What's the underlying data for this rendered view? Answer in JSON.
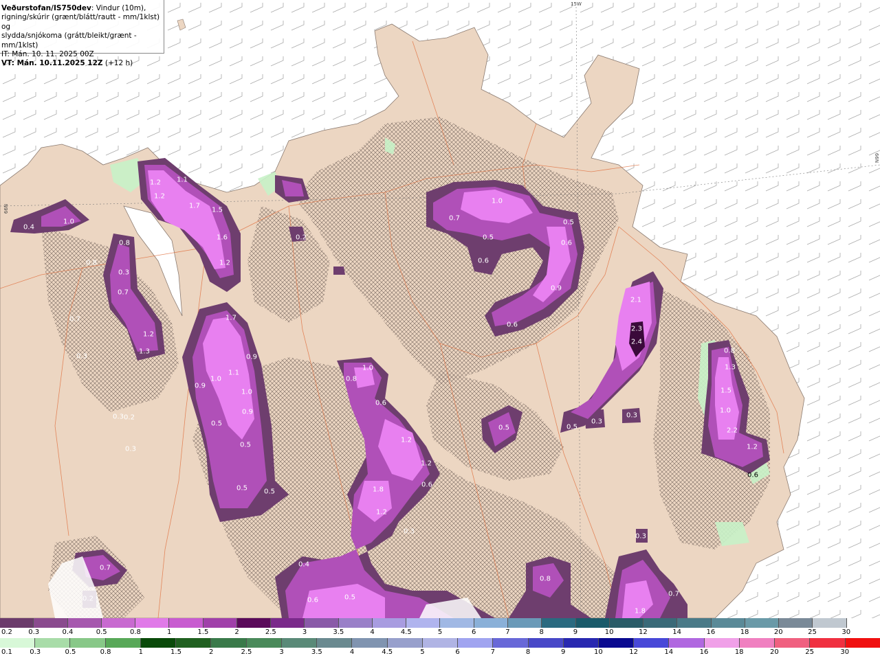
{
  "title": {
    "line1_bold": "Veðurstofan/IS750dev",
    "line1_rest": ": Vindur (10m),",
    "line2": "rigning/skúrir (grænt/blátt/rautt - mm/1klst) og",
    "line3": "slydda/snjókoma (grátt/bleikt/grænt - mm/1klst)",
    "line4": "IT: Mán. 10. 11. 2025 00Z",
    "line5_bold": "VT: Mán. 10.11.2025 12Z",
    "line5_rest": " (+12 h)"
  },
  "grid_labels": {
    "lon": "15W",
    "lat": "66N"
  },
  "colors": {
    "sea": "#ffffff",
    "land": "#ecd6c2",
    "roads": "#e07040",
    "snow_dark": "#6e3e6e",
    "snow_mid": "#b050b8",
    "snow_light": "#e880f0",
    "snow_core": "#3a0a3a",
    "rain_light": "#c8f2c8"
  },
  "precip_labels": [
    "1.2",
    "1.1",
    "1.2",
    "1.7",
    "1.5",
    "1.6",
    "1.2",
    "0.8",
    "0.4",
    "1.0",
    "0.8",
    "0.3",
    "0.7",
    "0.7",
    "1.2",
    "1.3",
    "0.3",
    "0.3",
    "0.2",
    "0.3",
    "1.7",
    "0.9",
    "1.0",
    "1.1",
    "0.9",
    "1.0",
    "0.9",
    "0.5",
    "0.5",
    "0.5",
    "0.5",
    "0.2",
    "1.0",
    "0.8",
    "0.6",
    "1.2",
    "1.2",
    "0.6",
    "1.8",
    "1.2",
    "0.3",
    "1.0",
    "0.7",
    "0.5",
    "0.6",
    "0.5",
    "0.6",
    "0.9",
    "0.6",
    "2.1",
    "2.3",
    "2.4",
    "0.5",
    "0.3",
    "0.5",
    "0.3",
    "0.8",
    "1.3",
    "1.5",
    "1.0",
    "2.2",
    "1.2",
    "0.6",
    "0.4",
    "0.6",
    "0.5",
    "0.3",
    "0.8",
    "1.8",
    "0.7",
    "0.7",
    "0.2"
  ],
  "snow_scale": {
    "labels": [
      "0.2",
      "0.3",
      "0.4",
      "0.5",
      "0.8",
      "1",
      "1.5",
      "2",
      "2.5",
      "3",
      "3.5",
      "4",
      "4.5",
      "5",
      "6",
      "7",
      "8",
      "9",
      "10",
      "12",
      "14",
      "16",
      "18",
      "20",
      "25",
      "30"
    ],
    "colors": [
      "#6b3b6b",
      "#8a4a8e",
      "#a658ae",
      "#c86ad0",
      "#e07ae8",
      "#c85cd0",
      "#a040aa",
      "#5a0a5a",
      "#7a2a8a",
      "#8a5aa8",
      "#9a80c8",
      "#a89ce0",
      "#b0b4ee",
      "#a0b8e4",
      "#8ab0d8",
      "#6a9ab8",
      "#2a6a80",
      "#1a5a6a",
      "#2a5c68",
      "#3a6a78",
      "#4a7a88",
      "#5a8a98",
      "#6a9aa8",
      "#7a8a98",
      "#c0c8d0",
      "#ffffff"
    ]
  },
  "rain_scale": {
    "labels": [
      "0.1",
      "0.3",
      "0.5",
      "0.8",
      "1",
      "1.5",
      "2",
      "2.5",
      "3",
      "3.5",
      "4",
      "4.5",
      "5",
      "6",
      "7",
      "8",
      "9",
      "10",
      "12",
      "14",
      "16",
      "18",
      "20",
      "25",
      "30"
    ],
    "colors": [
      "#d8f8d8",
      "#a8dca8",
      "#88c888",
      "#58a858",
      "#0a4a0a",
      "#206020",
      "#3a7a4a",
      "#4a8a5a",
      "#5a8a78",
      "#6a8a90",
      "#8094b0",
      "#98a0cc",
      "#b0b4e4",
      "#a0a4f0",
      "#6868d8",
      "#4848c8",
      "#2828b0",
      "#0a0a90",
      "#4848d8",
      "#b068e0",
      "#f0a0e8",
      "#f080c0",
      "#f06080",
      "#f03040",
      "#f01010"
    ]
  }
}
